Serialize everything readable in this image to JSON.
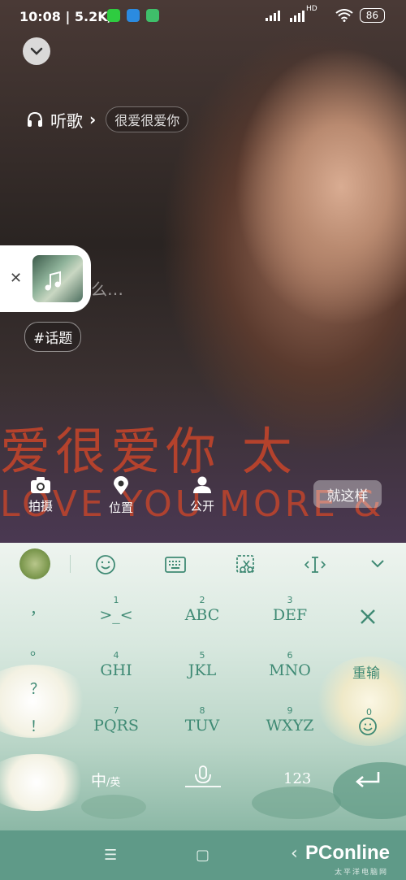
{
  "status": {
    "time": "10:08 | 5.2K/s",
    "battery": "86",
    "network": "HD"
  },
  "listen": {
    "label": "听歌",
    "arrow": "›",
    "song": "很爱很爱你"
  },
  "placeholder": "么…",
  "topic_tag": "#话题",
  "lyrics_art": {
    "line1": "爱很爱你 太",
    "line2": "LOVE YOU MORE &"
  },
  "tools": [
    {
      "label": "拍摄",
      "icon": "camera-icon"
    },
    {
      "label": "位置",
      "icon": "location-pin-icon"
    },
    {
      "label": "公开",
      "icon": "person-icon"
    }
  ],
  "done_button": "就这样",
  "keyboard": {
    "toolbar_icons": [
      "keyboard-logo-icon",
      "emoji-icon",
      "keyboard-icon",
      "clipboard-cut-icon",
      "cursor-icon",
      "collapse-keyboard-icon"
    ],
    "side_symbols": [
      "，",
      "。",
      "？",
      "！"
    ],
    "keys": [
      {
        "num": "1",
        "label": ">_<"
      },
      {
        "num": "2",
        "label": "ABC"
      },
      {
        "num": "3",
        "label": "DEF"
      },
      {
        "num": "4",
        "label": "GHI"
      },
      {
        "num": "5",
        "label": "JKL"
      },
      {
        "num": "6",
        "label": "MNO"
      },
      {
        "num": "7",
        "label": "PQRS"
      },
      {
        "num": "8",
        "label": "TUV"
      },
      {
        "num": "9",
        "label": "WXYZ"
      }
    ],
    "delete_icon": "delete-icon",
    "retype": "重输",
    "zero_num": "0",
    "lang_main": "中",
    "lang_sub": "/英",
    "numbers": "123",
    "enter_icon": "enter-icon",
    "mic_icon": "microphone-icon"
  },
  "navbar": {
    "menu": "☰",
    "home": "▢",
    "back": "‹",
    "brand": "PConline",
    "brand_sub": "太平洋电脑网"
  }
}
